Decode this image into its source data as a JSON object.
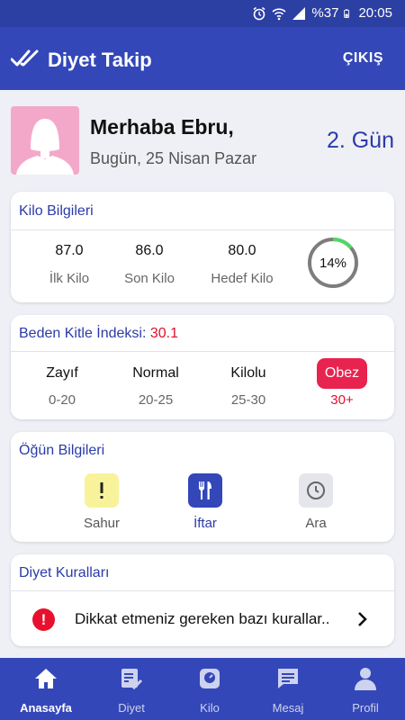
{
  "status_bar": {
    "battery": "%37",
    "time": "20:05"
  },
  "app_bar": {
    "title": "Diyet Takip",
    "logout_label": "ÇIKIŞ"
  },
  "profile": {
    "greeting": "Merhaba Ebru,",
    "date": "Bugün, 25 Nisan Pazar",
    "day": "2. Gün"
  },
  "weight": {
    "title": "Kilo Bilgileri",
    "items": [
      {
        "value": "87.0",
        "label": "İlk Kilo"
      },
      {
        "value": "86.0",
        "label": "Son Kilo"
      },
      {
        "value": "80.0",
        "label": "Hedef Kilo"
      }
    ],
    "progress_label": "14%",
    "progress_value": 0.14,
    "progress_color": "#4cd964"
  },
  "bmi": {
    "title": "Beden Kitle İndeksi:",
    "value": "30.1",
    "value_color": "#e0102e",
    "categories": [
      {
        "name": "Zayıf",
        "range": "0-20"
      },
      {
        "name": "Normal",
        "range": "20-25"
      },
      {
        "name": "Kilolu",
        "range": "25-30"
      },
      {
        "name": "Obez",
        "range": "30+"
      }
    ],
    "active_color": "#e8234f"
  },
  "meals": {
    "title": "Öğün Bilgileri",
    "items": [
      {
        "label": "Sahur",
        "icon": "exclamation-icon"
      },
      {
        "label": "İftar",
        "icon": "fork-knife-icon"
      },
      {
        "label": "Ara",
        "icon": "clock-icon"
      }
    ]
  },
  "rules": {
    "title": "Diyet Kuralları",
    "text": "Dikkat etmeniz gereken bazı kurallar..",
    "alert_glyph": "!"
  },
  "nav": [
    {
      "label": "Anasayfa",
      "icon": "home-icon"
    },
    {
      "label": "Diyet",
      "icon": "clipboard-check-icon"
    },
    {
      "label": "Kilo",
      "icon": "scale-icon"
    },
    {
      "label": "Mesaj",
      "icon": "message-icon"
    },
    {
      "label": "Profil",
      "icon": "user-icon"
    }
  ],
  "colors": {
    "primary": "#3447b8",
    "status": "#2c3fa3",
    "accent_text": "#2b3ba8",
    "background": "#eef0f5"
  }
}
